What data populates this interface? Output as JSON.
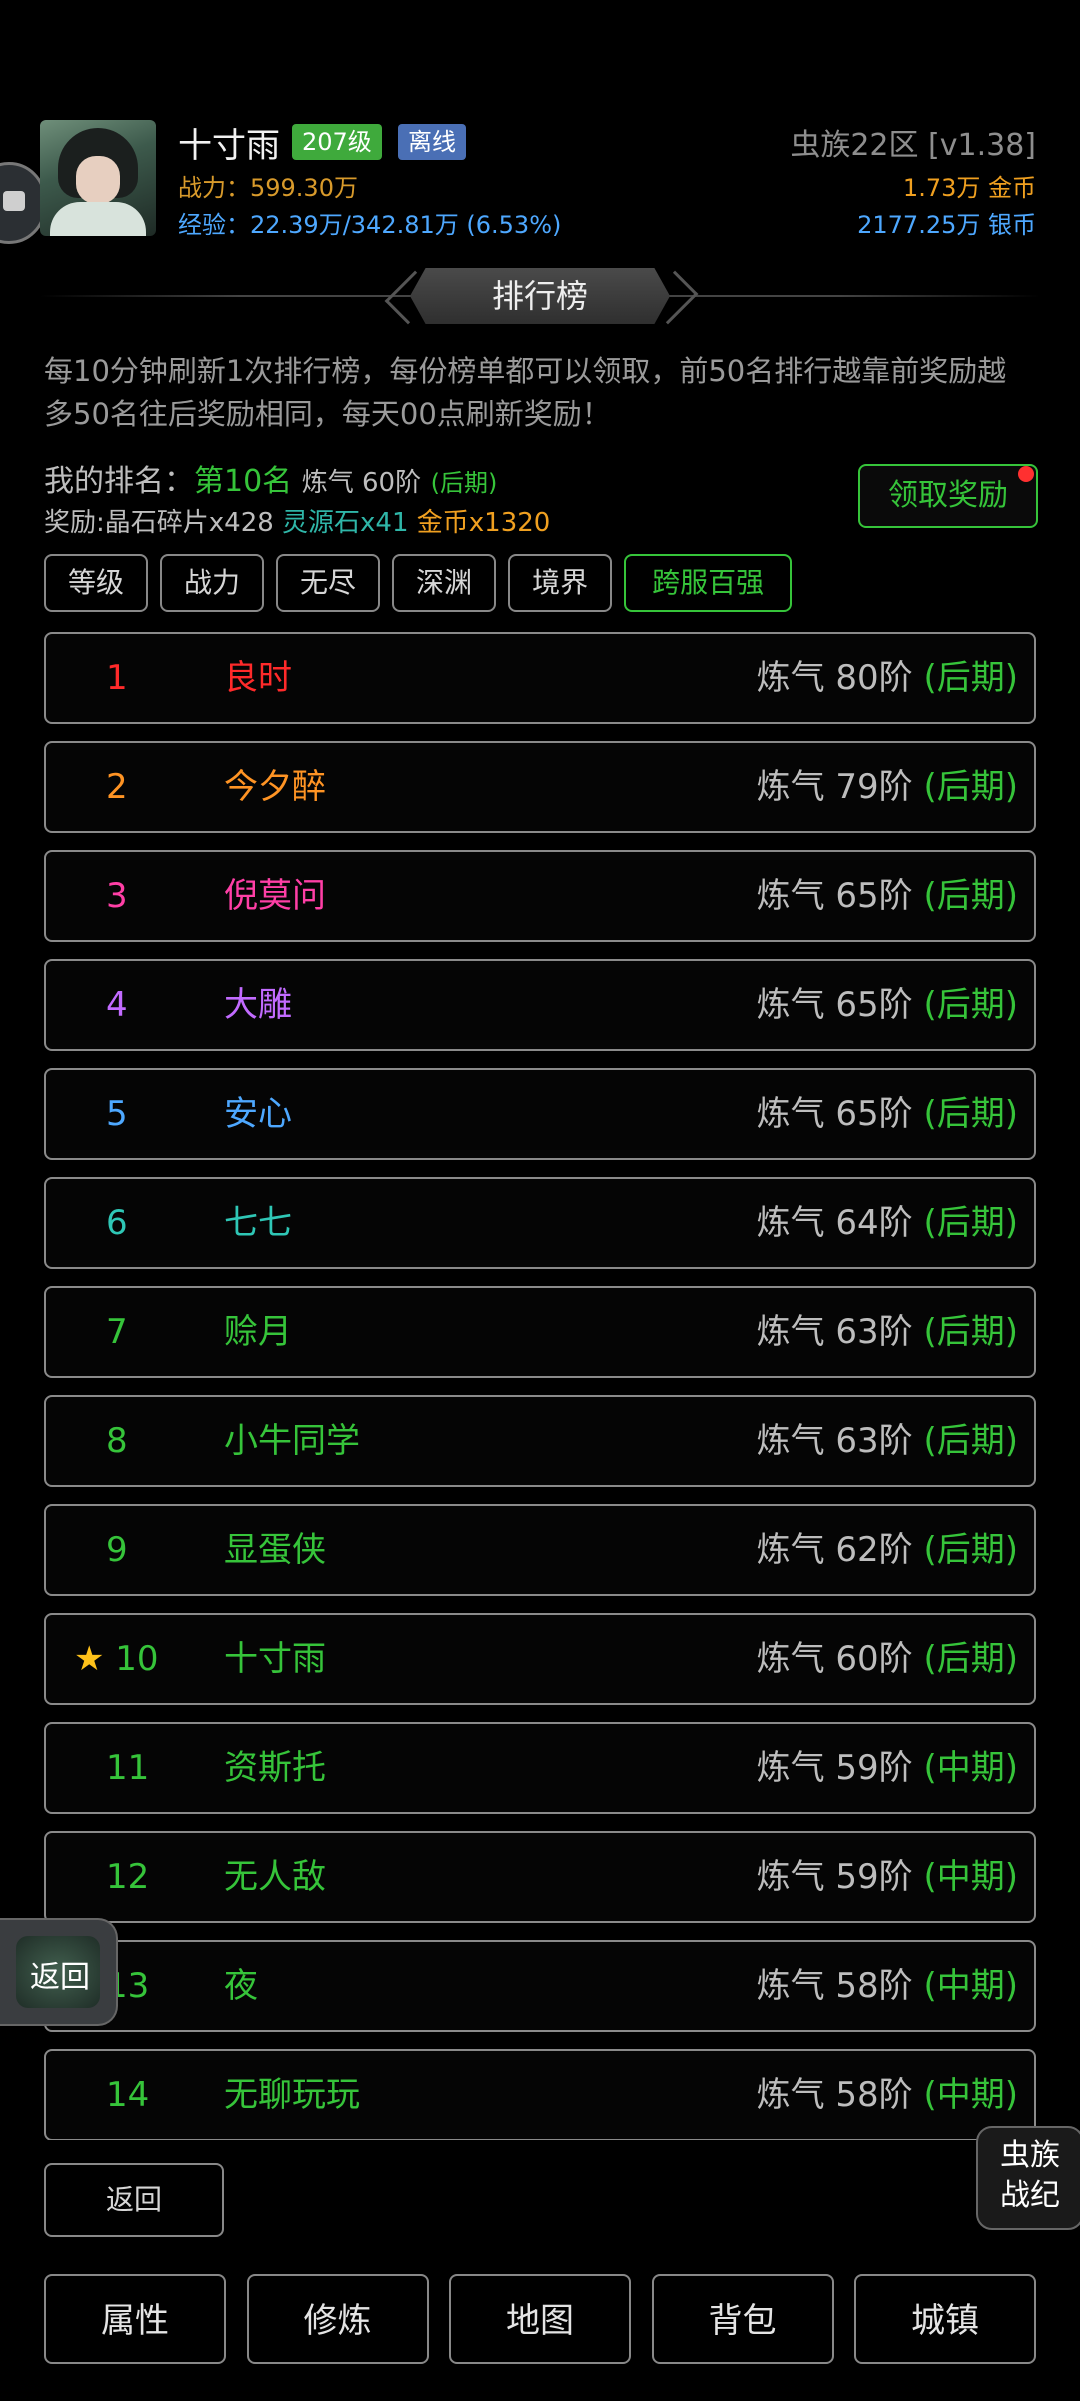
{
  "player": {
    "name": "十寸雨",
    "level_badge": "207级",
    "status_badge": "离线",
    "power": "战力：599.30万",
    "exp": "经验：22.39万/342.81万 (6.53%)",
    "server": "虫族22区 [v1.38]",
    "gold": "1.73万 金币",
    "silver": "2177.25万 银币"
  },
  "title": "排行榜",
  "description": "每10分钟刷新1次排行榜，每份榜单都可以领取，前50名排行越靠前奖励越多50名往后奖励相同，每天00点刷新奖励！",
  "my_rank": {
    "label": "我的排名：",
    "rank": "第10名",
    "level": "炼气 60阶",
    "stage": "(后期)",
    "reward_label": "奖励:晶石碎片x428",
    "reward_green": "灵源石x41",
    "reward_gold": "金币x1320",
    "claim_button": "领取奖励"
  },
  "tabs": [
    "等级",
    "战力",
    "无尽",
    "深渊",
    "境界",
    "跨服百强"
  ],
  "active_tab": 5,
  "rows": [
    {
      "rank": "1",
      "name": "良时",
      "level": "炼气 80阶",
      "stage": "(后期)",
      "color": "#ff2a2a"
    },
    {
      "rank": "2",
      "name": "今夕醉",
      "level": "炼气 79阶",
      "stage": "(后期)",
      "color": "#ff9424"
    },
    {
      "rank": "3",
      "name": "倪莫问",
      "level": "炼气 65阶",
      "stage": "(后期)",
      "color": "#ff3fa6"
    },
    {
      "rank": "4",
      "name": "大雕",
      "level": "炼气 65阶",
      "stage": "(后期)",
      "color": "#c26bff"
    },
    {
      "rank": "5",
      "name": "安心",
      "level": "炼气 65阶",
      "stage": "(后期)",
      "color": "#4ea8ff"
    },
    {
      "rank": "6",
      "name": "七七",
      "level": "炼气 64阶",
      "stage": "(后期)",
      "color": "#2fc7b6"
    },
    {
      "rank": "7",
      "name": "赊月",
      "level": "炼气 63阶",
      "stage": "(后期)",
      "color": "#36c43a"
    },
    {
      "rank": "8",
      "name": "小牛同学",
      "level": "炼气 63阶",
      "stage": "(后期)",
      "color": "#36c43a"
    },
    {
      "rank": "9",
      "name": "显蛋侠",
      "level": "炼气 62阶",
      "stage": "(后期)",
      "color": "#36c43a"
    },
    {
      "rank": "★ 10",
      "name": "十寸雨",
      "level": "炼气 60阶",
      "stage": "(后期)",
      "color": "#36c43a",
      "star_color": "#ffc21a"
    },
    {
      "rank": "11",
      "name": "资斯托",
      "level": "炼气 59阶",
      "stage": "(中期)",
      "color": "#36c43a"
    },
    {
      "rank": "12",
      "name": "无人敌",
      "level": "炼气 59阶",
      "stage": "(中期)",
      "color": "#36c43a"
    },
    {
      "rank": "13",
      "name": "夜",
      "level": "炼气 58阶",
      "stage": "(中期)",
      "color": "#36c43a"
    },
    {
      "rank": "14",
      "name": "无聊玩玩",
      "level": "炼气 58阶",
      "stage": "(中期)",
      "color": "#36c43a"
    }
  ],
  "float_back": "返回",
  "logo_text": [
    "虫族",
    "战纪"
  ],
  "back_button": "返回",
  "nav": [
    "属性",
    "修炼",
    "地图",
    "背包",
    "城镇"
  ]
}
